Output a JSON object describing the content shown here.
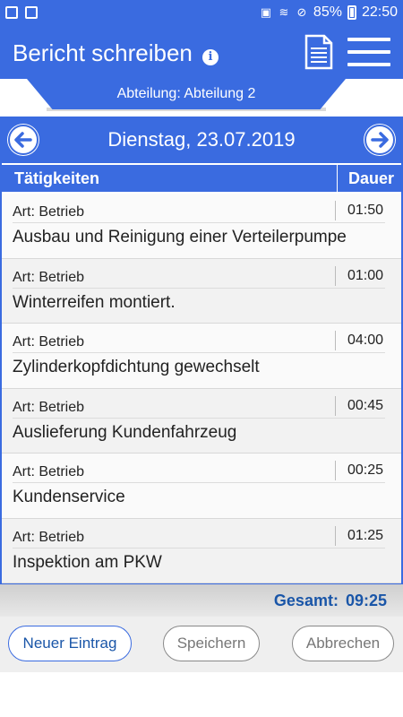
{
  "status": {
    "battery": "85%",
    "time": "22:50"
  },
  "appbar": {
    "title": "Bericht schreiben"
  },
  "department": {
    "label": "Abteilung: Abteilung 2"
  },
  "datebar": {
    "date": "Dienstag, 23.07.2019"
  },
  "columns": {
    "activities": "Tätigkeiten",
    "duration": "Dauer"
  },
  "entries": [
    {
      "art": "Art: Betrieb",
      "duration": "01:50",
      "description": "Ausbau und Reinigung einer Verteilerpumpe"
    },
    {
      "art": "Art: Betrieb",
      "duration": "01:00",
      "description": "Winterreifen montiert."
    },
    {
      "art": "Art: Betrieb",
      "duration": "04:00",
      "description": "Zylinderkopfdichtung gewechselt"
    },
    {
      "art": "Art: Betrieb",
      "duration": "00:45",
      "description": "Auslieferung Kundenfahrzeug"
    },
    {
      "art": "Art: Betrieb",
      "duration": "00:25",
      "description": "Kundenservice"
    },
    {
      "art": "Art: Betrieb",
      "duration": "01:25",
      "description": "Inspektion am PKW"
    }
  ],
  "total": {
    "label": "Gesamt:",
    "value": "09:25"
  },
  "buttons": {
    "new_entry": "Neuer Eintrag",
    "save": "Speichern",
    "cancel": "Abbrechen"
  },
  "colors": {
    "accent": "#3a6be0",
    "total_text": "#1a56a8"
  }
}
